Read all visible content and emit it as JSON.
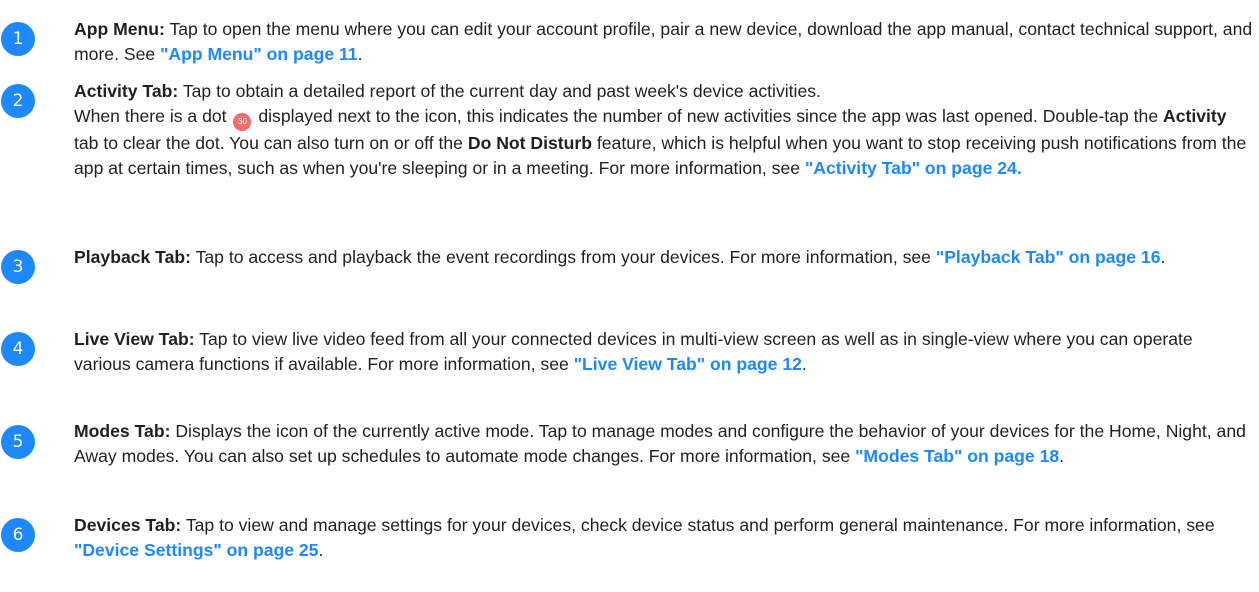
{
  "colors": {
    "badge": "#1e88ff",
    "link": "#1e88ff",
    "dot": "#f26d6d",
    "text": "#231f20"
  },
  "items": [
    {
      "number": "1",
      "term": "App Menu:",
      "text": " Tap to open the menu where you can edit your account profile, pair a new device, download the app manual, contact technical support, and more. See ",
      "link": "\"App Menu\" on page 11",
      "end": "."
    },
    {
      "number": "2",
      "term": "Activity Tab:",
      "text": " Tap to obtain a detailed report of the current day and past week's device activities.",
      "line2_a": "When there is a dot ",
      "dot_label": "30",
      "line2_b": " displayed next to the icon, this indicates the number of new activities since the app was last opened. Double-tap the ",
      "bold_activity": "Activity",
      "line2_c": " tab to clear the dot. You can also turn on or off the ",
      "bold_dnd": "Do Not Disturb",
      "line2_d": " feature, which is helpful when you want to stop receiving push notifications from the app at certain times, such as when you're sleeping or in a meeting. For more information, see ",
      "link": "\"Activity Tab\" on page 24."
    },
    {
      "number": "3",
      "term": "Playback Tab:",
      "text": " Tap to access and playback the event recordings from your devices. For more information, see ",
      "link": "\"Playback Tab\" on page 16",
      "end": "."
    },
    {
      "number": "4",
      "term": "Live View Tab:",
      "text": " Tap to view live video feed from all your connected devices in multi-view screen as well as in single-view where you can operate various camera functions if available. For more information, see ",
      "link": "\"Live View Tab\" on page 12",
      "end": "."
    },
    {
      "number": "5",
      "term": "Modes Tab:",
      "text": " Displays the icon of the currently active mode. Tap to manage modes and configure the behavior of your devices for the Home, Night, and Away modes. You can also set up schedules to automate mode changes. For more information, see ",
      "link": "\"Modes Tab\" on page 18",
      "end": "."
    },
    {
      "number": "6",
      "term": "Devices Tab:",
      "text": " Tap to view and manage settings for your devices, check device status and perform general maintenance. For more information, see ",
      "link": "\"Device Settings\" on page 25",
      "end": "."
    }
  ]
}
